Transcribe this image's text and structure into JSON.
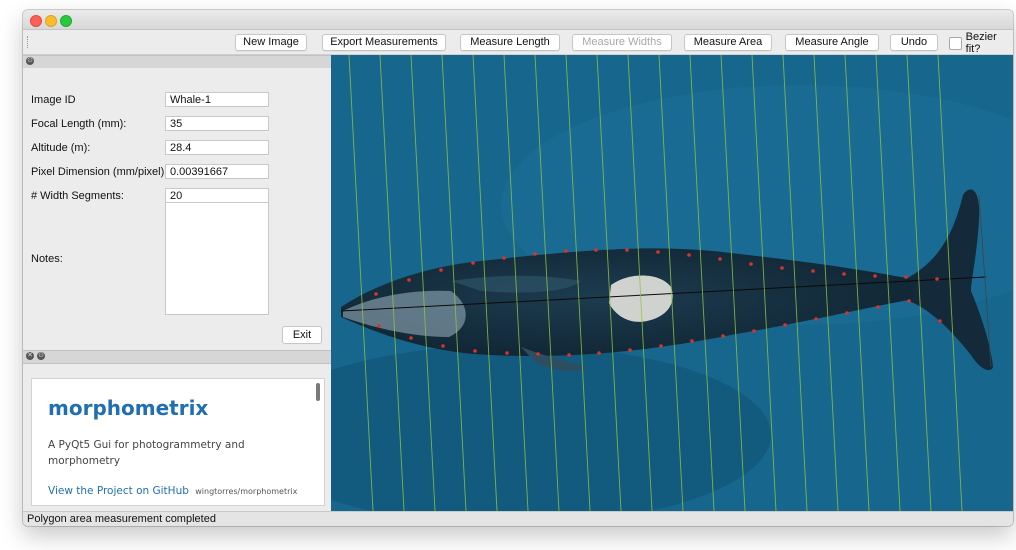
{
  "toolbar": {
    "new_image": "New Image",
    "export_measurements": "Export Measurements",
    "measure_length": "Measure Length",
    "measure_widths": "Measure Widths",
    "measure_area": "Measure Area",
    "measure_angle": "Measure Angle",
    "undo": "Undo",
    "bezier_fit": "Bezier fit?",
    "bezier_checked": false
  },
  "form": {
    "image_id_label": "Image ID",
    "image_id_value": "Whale-1",
    "focal_length_label": "Focal Length (mm):",
    "focal_length_value": "35",
    "altitude_label": "Altitude (m):",
    "altitude_value": "28.4",
    "pixel_dimension_label": "Pixel Dimension (mm/pixel)",
    "pixel_dimension_value": "0.00391667",
    "width_segments_label": "# Width Segments:",
    "width_segments_value": "20",
    "notes_label": "Notes:",
    "notes_value": "",
    "exit_label": "Exit"
  },
  "about": {
    "title": "morphometrix",
    "description": "A PyQt5 Gui for photogrammetry and morphometry",
    "link_text": "View the Project on GitHub",
    "repo": "wingtorres/morphometrix"
  },
  "status": {
    "message": "Polygon area measurement completed"
  },
  "colors": {
    "ocean": "#17658c",
    "guide_lines": "#7fbf3a",
    "measure_points": "#d9342b",
    "link": "#1f6fb2"
  },
  "icons": {
    "panel_float": "float-icon",
    "panel_close": "close-icon"
  }
}
